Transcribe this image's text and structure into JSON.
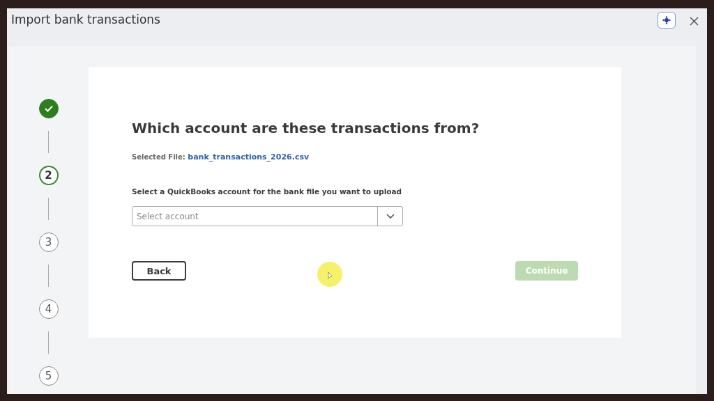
{
  "window": {
    "title": "Import bank transactions"
  },
  "steps": [
    {
      "kind": "done"
    },
    {
      "kind": "current",
      "label": "2"
    },
    {
      "kind": "upcoming",
      "label": "3"
    },
    {
      "kind": "upcoming",
      "label": "4"
    },
    {
      "kind": "upcoming",
      "label": "5"
    }
  ],
  "form": {
    "heading": "Which account are these transactions from?",
    "file_label": "Selected File:",
    "file_name": "bank_transactions_2026.csv",
    "account_label": "Select a QuickBooks account for the bank file you want to upload",
    "account_field": {
      "placeholder": "Select account"
    }
  },
  "buttons": [
    {
      "label": "Back",
      "kind": "secondary",
      "disabled": false
    },
    {
      "label": "Continue",
      "kind": "primary",
      "disabled": true
    }
  ]
}
